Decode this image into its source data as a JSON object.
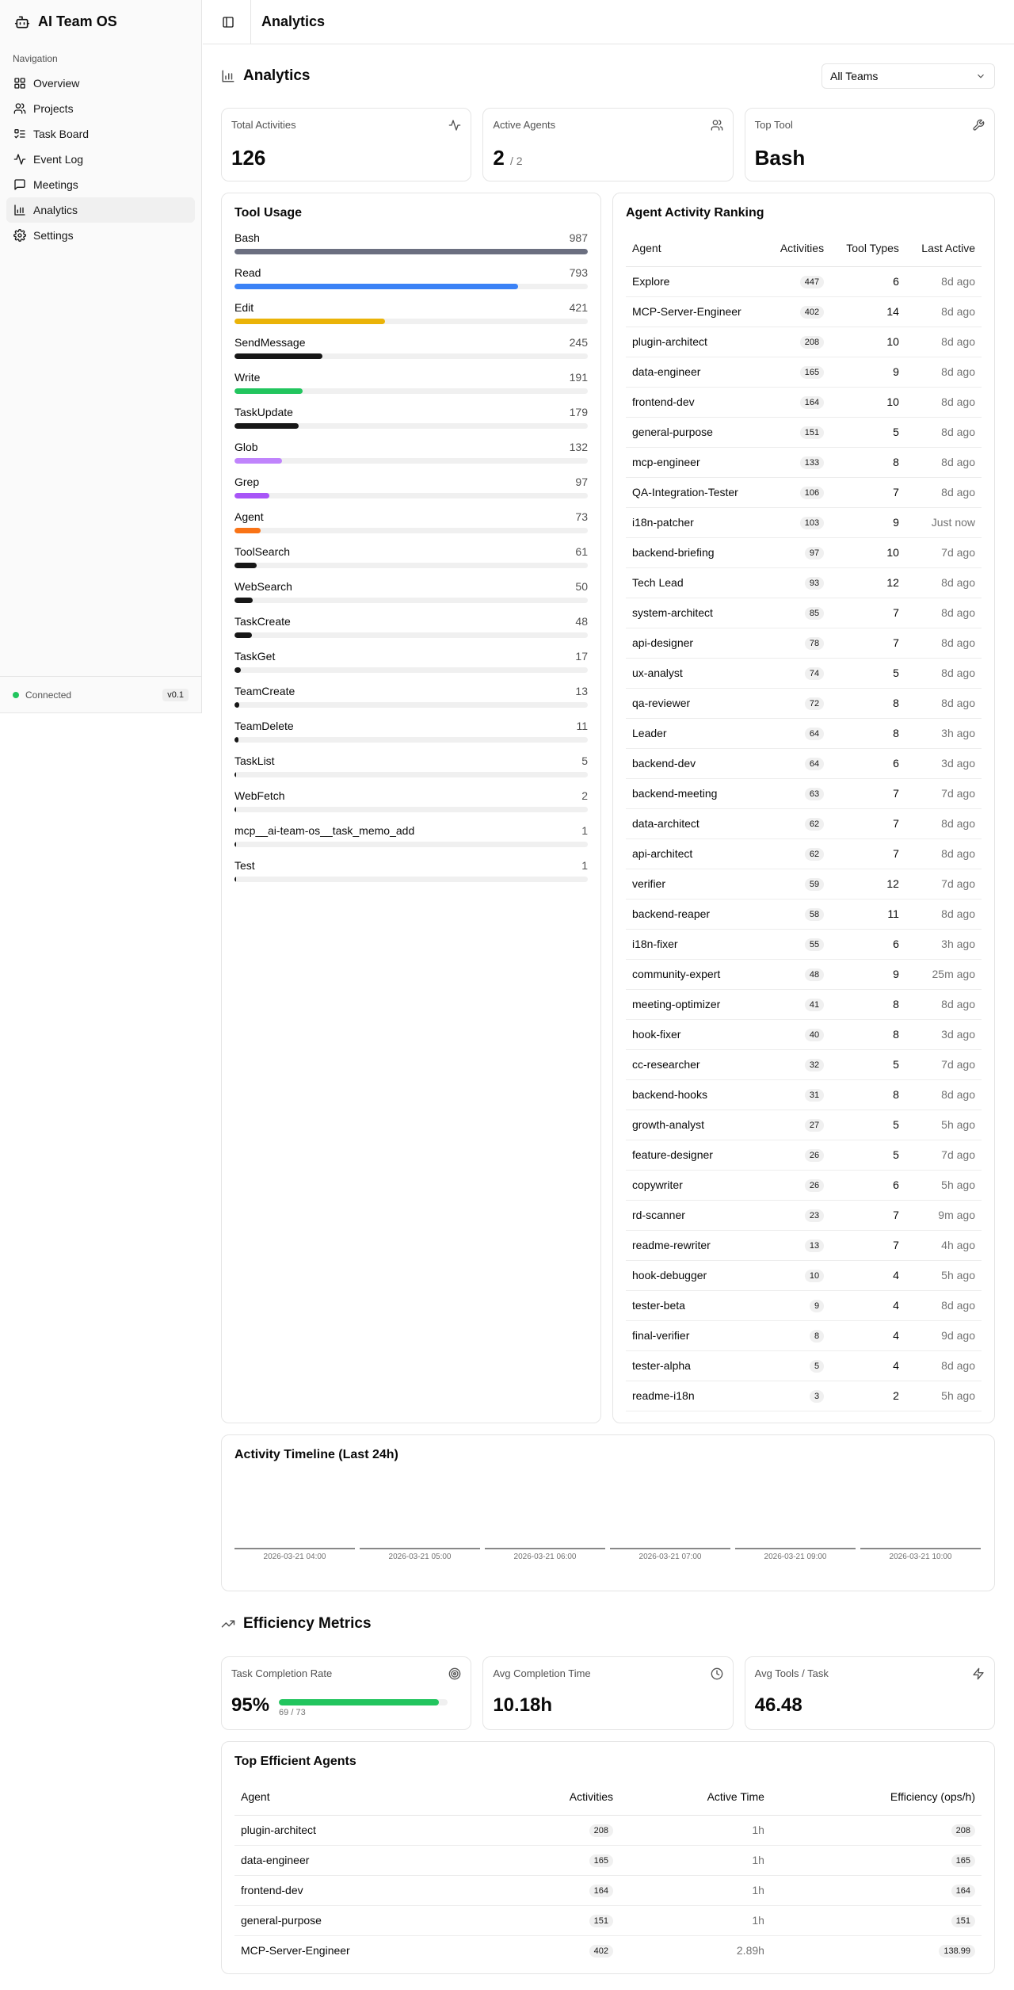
{
  "app": {
    "name": "AI Team OS",
    "version": "v0.1",
    "status": "Connected"
  },
  "header": {
    "title": "Analytics"
  },
  "sidebar": {
    "section_label": "Navigation",
    "items": [
      {
        "label": "Overview",
        "icon": "grid-icon"
      },
      {
        "label": "Projects",
        "icon": "users-icon"
      },
      {
        "label": "Task Board",
        "icon": "list-checks-icon"
      },
      {
        "label": "Event Log",
        "icon": "activity-icon"
      },
      {
        "label": "Meetings",
        "icon": "message-square-icon"
      },
      {
        "label": "Analytics",
        "icon": "bar-chart-icon",
        "active": true
      },
      {
        "label": "Settings",
        "icon": "gear-icon"
      }
    ]
  },
  "analytics": {
    "title": "Analytics",
    "team_filter": "All Teams",
    "stats": {
      "total_activities": {
        "label": "Total Activities",
        "value": "126"
      },
      "active_agents": {
        "label": "Active Agents",
        "value": "2",
        "total": "/ 2"
      },
      "top_tool": {
        "label": "Top Tool",
        "value": "Bash"
      }
    }
  },
  "tool_usage": {
    "title": "Tool Usage",
    "max": 987,
    "tools": [
      {
        "name": "Bash",
        "count": 987,
        "color": "#6b6f80"
      },
      {
        "name": "Read",
        "count": 793,
        "color": "#3b82f6"
      },
      {
        "name": "Edit",
        "count": 421,
        "color": "#eab308"
      },
      {
        "name": "SendMessage",
        "count": 245,
        "color": "#171717"
      },
      {
        "name": "Write",
        "count": 191,
        "color": "#22c55e"
      },
      {
        "name": "TaskUpdate",
        "count": 179,
        "color": "#171717"
      },
      {
        "name": "Glob",
        "count": 132,
        "color": "#c084fc"
      },
      {
        "name": "Grep",
        "count": 97,
        "color": "#a855f7"
      },
      {
        "name": "Agent",
        "count": 73,
        "color": "#f97316"
      },
      {
        "name": "ToolSearch",
        "count": 61,
        "color": "#171717"
      },
      {
        "name": "WebSearch",
        "count": 50,
        "color": "#171717"
      },
      {
        "name": "TaskCreate",
        "count": 48,
        "color": "#171717"
      },
      {
        "name": "TaskGet",
        "count": 17,
        "color": "#171717"
      },
      {
        "name": "TeamCreate",
        "count": 13,
        "color": "#171717"
      },
      {
        "name": "TeamDelete",
        "count": 11,
        "color": "#171717"
      },
      {
        "name": "TaskList",
        "count": 5,
        "color": "#171717"
      },
      {
        "name": "WebFetch",
        "count": 2,
        "color": "#171717"
      },
      {
        "name": "mcp__ai-team-os__task_memo_add",
        "count": 1,
        "color": "#171717"
      },
      {
        "name": "Test",
        "count": 1,
        "color": "#171717"
      }
    ]
  },
  "ranking": {
    "title": "Agent Activity Ranking",
    "columns": [
      "Agent",
      "Activities",
      "Tool Types",
      "Last Active"
    ],
    "rows": [
      [
        "Explore",
        "447",
        "6",
        "8d ago"
      ],
      [
        "MCP-Server-Engineer",
        "402",
        "14",
        "8d ago"
      ],
      [
        "plugin-architect",
        "208",
        "10",
        "8d ago"
      ],
      [
        "data-engineer",
        "165",
        "9",
        "8d ago"
      ],
      [
        "frontend-dev",
        "164",
        "10",
        "8d ago"
      ],
      [
        "general-purpose",
        "151",
        "5",
        "8d ago"
      ],
      [
        "mcp-engineer",
        "133",
        "8",
        "8d ago"
      ],
      [
        "QA-Integration-Tester",
        "106",
        "7",
        "8d ago"
      ],
      [
        "i18n-patcher",
        "103",
        "9",
        "Just now"
      ],
      [
        "backend-briefing",
        "97",
        "10",
        "7d ago"
      ],
      [
        "Tech Lead",
        "93",
        "12",
        "8d ago"
      ],
      [
        "system-architect",
        "85",
        "7",
        "8d ago"
      ],
      [
        "api-designer",
        "78",
        "7",
        "8d ago"
      ],
      [
        "ux-analyst",
        "74",
        "5",
        "8d ago"
      ],
      [
        "qa-reviewer",
        "72",
        "8",
        "8d ago"
      ],
      [
        "Leader",
        "64",
        "8",
        "3h ago"
      ],
      [
        "backend-dev",
        "64",
        "6",
        "3d ago"
      ],
      [
        "backend-meeting",
        "63",
        "7",
        "7d ago"
      ],
      [
        "data-architect",
        "62",
        "7",
        "8d ago"
      ],
      [
        "api-architect",
        "62",
        "7",
        "8d ago"
      ],
      [
        "verifier",
        "59",
        "12",
        "7d ago"
      ],
      [
        "backend-reaper",
        "58",
        "11",
        "8d ago"
      ],
      [
        "i18n-fixer",
        "55",
        "6",
        "3h ago"
      ],
      [
        "community-expert",
        "48",
        "9",
        "25m ago"
      ],
      [
        "meeting-optimizer",
        "41",
        "8",
        "8d ago"
      ],
      [
        "hook-fixer",
        "40",
        "8",
        "3d ago"
      ],
      [
        "cc-researcher",
        "32",
        "5",
        "7d ago"
      ],
      [
        "backend-hooks",
        "31",
        "8",
        "8d ago"
      ],
      [
        "growth-analyst",
        "27",
        "5",
        "5h ago"
      ],
      [
        "feature-designer",
        "26",
        "5",
        "7d ago"
      ],
      [
        "copywriter",
        "26",
        "6",
        "5h ago"
      ],
      [
        "rd-scanner",
        "23",
        "7",
        "9m ago"
      ],
      [
        "readme-rewriter",
        "13",
        "7",
        "4h ago"
      ],
      [
        "hook-debugger",
        "10",
        "4",
        "5h ago"
      ],
      [
        "tester-beta",
        "9",
        "4",
        "8d ago"
      ],
      [
        "final-verifier",
        "8",
        "4",
        "9d ago"
      ],
      [
        "tester-alpha",
        "5",
        "4",
        "8d ago"
      ],
      [
        "readme-i18n",
        "3",
        "2",
        "5h ago"
      ]
    ]
  },
  "timeline": {
    "title": "Activity Timeline (Last 24h)",
    "labels": [
      "2026-03-21 04:00",
      "2026-03-21 05:00",
      "2026-03-21 06:00",
      "2026-03-21 07:00",
      "2026-03-21 09:00",
      "2026-03-21 10:00"
    ]
  },
  "efficiency": {
    "title": "Efficiency Metrics",
    "completion_rate": {
      "label": "Task Completion Rate",
      "value": "95%",
      "fraction": 0.95,
      "sub": "69 / 73"
    },
    "avg_completion_time": {
      "label": "Avg Completion Time",
      "value": "10.18h"
    },
    "avg_tools": {
      "label": "Avg Tools / Task",
      "value": "46.48"
    }
  },
  "top_efficient": {
    "title": "Top Efficient Agents",
    "columns": [
      "Agent",
      "Activities",
      "Active Time",
      "Efficiency (ops/h)"
    ],
    "rows": [
      [
        "plugin-architect",
        "208",
        "1h",
        "208"
      ],
      [
        "data-engineer",
        "165",
        "1h",
        "165"
      ],
      [
        "frontend-dev",
        "164",
        "1h",
        "164"
      ],
      [
        "general-purpose",
        "151",
        "1h",
        "151"
      ],
      [
        "MCP-Server-Engineer",
        "402",
        "2.89h",
        "138.99"
      ]
    ]
  }
}
